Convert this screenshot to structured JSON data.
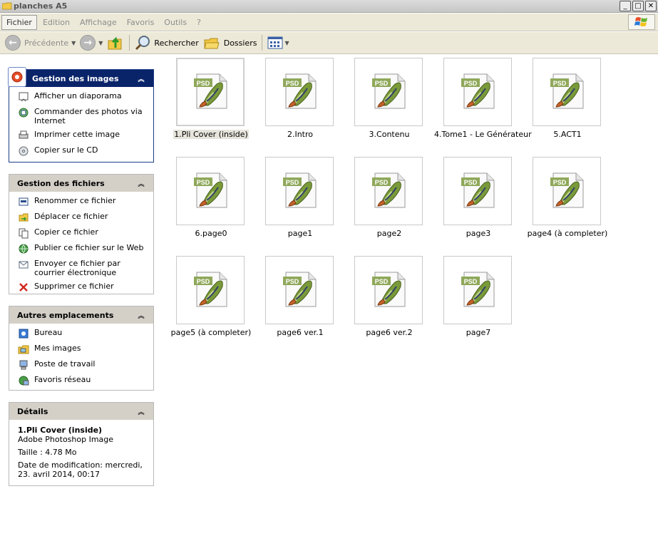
{
  "window": {
    "title": "planches A5"
  },
  "menu": [
    "Fichier",
    "Edition",
    "Affichage",
    "Favoris",
    "Outils",
    "?"
  ],
  "toolbar": {
    "back_label": "Précédente",
    "search_label": "Rechercher",
    "folders_label": "Dossiers"
  },
  "panels": {
    "images": {
      "title": "Gestion des images",
      "items": [
        "Afficher un diaporama",
        "Commander des photos via Internet",
        "Imprimer cette image",
        "Copier sur le CD"
      ]
    },
    "files": {
      "title": "Gestion des fichiers",
      "items": [
        "Renommer ce fichier",
        "Déplacer ce fichier",
        "Copier ce fichier",
        "Publier ce fichier sur le Web",
        "Envoyer ce fichier par courrier électronique",
        "Supprimer ce fichier"
      ]
    },
    "places": {
      "title": "Autres emplacements",
      "items": [
        "Bureau",
        "Mes images",
        "Poste de travail",
        "Favoris réseau"
      ]
    },
    "details": {
      "title": "Détails",
      "name": "1.Pli Cover (inside)",
      "type": "Adobe Photoshop Image",
      "size": "Taille : 4.78 Mo",
      "modified": "Date de modification: mercredi, 23. avril 2014, 00:17"
    }
  },
  "files": [
    "1.Pli Cover (inside)",
    "2.Intro",
    "3.Contenu",
    "4.Tome1 - Le Générateur",
    "5.ACT1",
    "6.page0",
    "page1",
    "page2",
    "page3",
    "page4 (à completer)",
    "page5 (à completer)",
    "page6 ver.1",
    "page6 ver.2",
    "page7"
  ],
  "icons": {
    "thumbnail": "psd-file-icon",
    "psd_badge": "PSD"
  }
}
